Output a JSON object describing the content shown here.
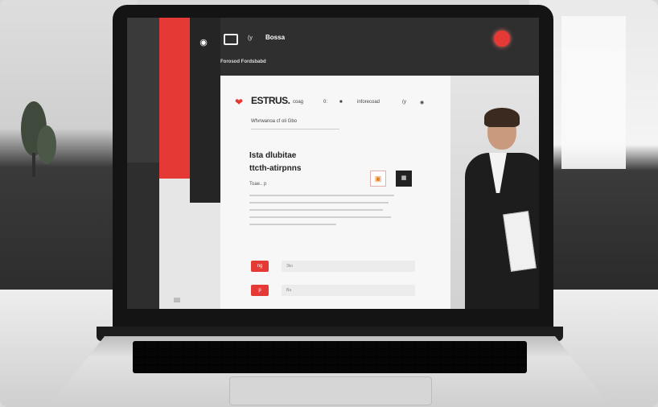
{
  "topbar": {
    "nav_1": "(y",
    "nav_2": "Bossa",
    "subnav": "Forosod Fordsbabd"
  },
  "sidebar": {
    "logo_glyph": "◉"
  },
  "card": {
    "brand": "ESTRUS.",
    "nav_items": [
      "coag",
      "0:",
      "■",
      "inforecoad",
      "(y",
      "◉"
    ],
    "subtitle": "Wfvrwanoa cf oli Gbo",
    "heading_1": "Ista dlubitae",
    "heading_2": "ttcth-atirpnns",
    "tagline": "Toae.. p",
    "button_1_label": "ng",
    "button_2_label": "p",
    "field_1_text": "3kn",
    "field_2_text": "Ba"
  },
  "colors": {
    "accent": "#e53935",
    "dark": "#2f2f2f",
    "card": "#f7f7f7"
  },
  "icons": [
    "heart-icon",
    "menu-icon",
    "avatar",
    "image-icon",
    "qr-icon"
  ]
}
